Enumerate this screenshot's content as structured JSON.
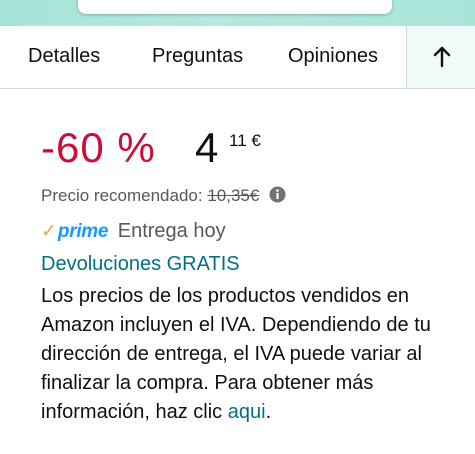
{
  "tabs": {
    "details": "Detalles",
    "questions": "Preguntas",
    "reviews": "Opiniones",
    "up_icon": "arrow-up-icon"
  },
  "price": {
    "discount": "-60 %",
    "whole": "4",
    "fraction": "11 €",
    "recommended_label": "Precio recomendado:",
    "recommended_value": "10,35€",
    "info_icon": "info-icon"
  },
  "delivery": {
    "prime_check": "✓",
    "prime_label": "prime",
    "text": "Entrega hoy"
  },
  "returns": {
    "text": "Devoluciones GRATIS"
  },
  "vat": {
    "text": "Los precios de los productos vendidos en Amazon incluyen el IVA. Dependiendo de tu dirección de entrega, el IVA puede variar al finalizar la compra. Para obtener más información, haz clic",
    "link": "aqui",
    "suffix": "."
  },
  "colors": {
    "discount": "#cc0c39",
    "link": "#007185",
    "prime_blue": "#1a98ff",
    "prime_check": "#f3a847",
    "header_accent": "#a6e3d8"
  }
}
